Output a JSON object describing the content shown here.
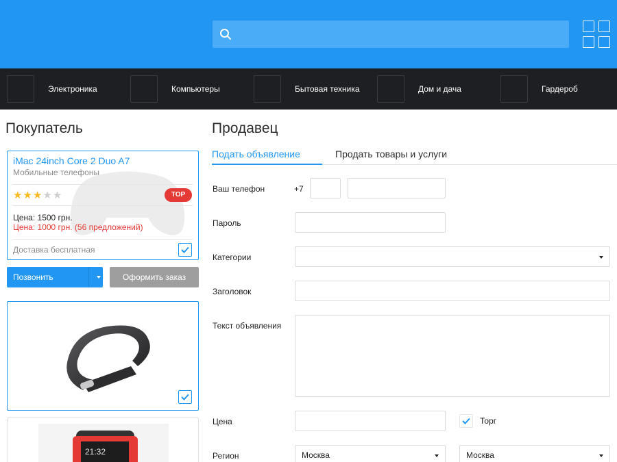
{
  "header": {
    "search_placeholder": ""
  },
  "categories": [
    {
      "label": "Электроника"
    },
    {
      "label": "Компьютеры"
    },
    {
      "label": "Бытовая техника"
    },
    {
      "label": "Дом и дача"
    },
    {
      "label": "Гардероб"
    }
  ],
  "buyer": {
    "title": "Покупатель",
    "product": {
      "title": "iMac 24inch Core 2 Duo A7",
      "category": "Мобильные телефоны",
      "rating": 3,
      "rating_max": 5,
      "badge": "TOP",
      "price": "Цена: 1500 грн.",
      "offers": "Цена: 1000 грн. (56 предложений)",
      "delivery": "Доставка бесплатная",
      "checked": true
    },
    "call_button": "Позвонить",
    "order_button": "Оформить заказ",
    "watch_time": "21:32"
  },
  "seller": {
    "title": "Продавец",
    "tabs": [
      {
        "label": "Подать объявление",
        "active": true
      },
      {
        "label": "Продать товары и услуги",
        "active": false
      }
    ],
    "form": {
      "phone_label": "Ваш телефон",
      "phone_prefix": "+7",
      "phone_code": "",
      "phone_number": "",
      "password_label": "Пароль",
      "category_label": "Категории",
      "category_value": "",
      "title_label": "Заголовок",
      "title_value": "",
      "text_label": "Текст объявления",
      "text_value": "",
      "price_label": "Цена",
      "price_value": "",
      "bargain_label": "Торг",
      "bargain_checked": true,
      "region_label": "Регион",
      "region_value": "Москва",
      "city_value": "Москва"
    }
  },
  "colors": {
    "primary": "#2196f3",
    "nav_dark": "#1e1f22",
    "badge_red": "#e53935",
    "star": "#f9b91e",
    "gray_button": "#9e9e9e"
  }
}
